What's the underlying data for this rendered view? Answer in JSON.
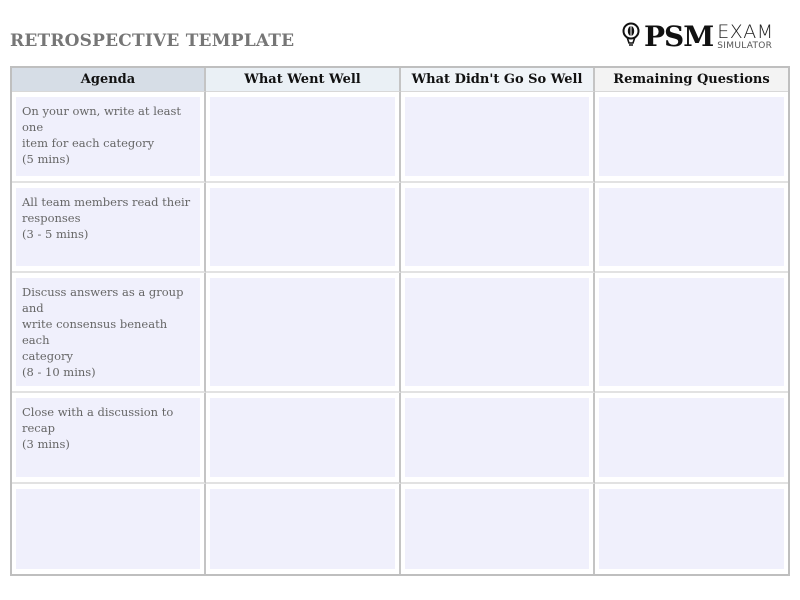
{
  "header": {
    "title": "RETROSPECTIVE TEMPLATE",
    "logo": {
      "icon": "lightbulb-icon",
      "brand": "PSM",
      "line1": "EXAM",
      "line2": "SIMULATOR"
    }
  },
  "table": {
    "columns": [
      "Agenda",
      "What Went Well",
      "What Didn't Go So Well",
      "Remaining Questions"
    ],
    "rows": [
      {
        "agenda": "On your own, write at least one\nitem for each category\n(5 mins)",
        "went_well": "",
        "didnt_go_well": "",
        "questions": ""
      },
      {
        "agenda": "All team members read their\nresponses\n(3 - 5 mins)",
        "went_well": "",
        "didnt_go_well": "",
        "questions": ""
      },
      {
        "agenda": "Discuss answers as a group and\nwrite consensus beneath each\ncategory\n(8 - 10 mins)",
        "went_well": "",
        "didnt_go_well": "",
        "questions": ""
      },
      {
        "agenda": "Close with a discussion to recap\n(3 mins)",
        "went_well": "",
        "didnt_go_well": "",
        "questions": ""
      },
      {
        "agenda": "",
        "went_well": "",
        "didnt_go_well": "",
        "questions": ""
      }
    ]
  },
  "colors": {
    "cell_fill": "#f0f0fc",
    "agenda_header": "#d6dde6",
    "title_gray": "#767676"
  }
}
